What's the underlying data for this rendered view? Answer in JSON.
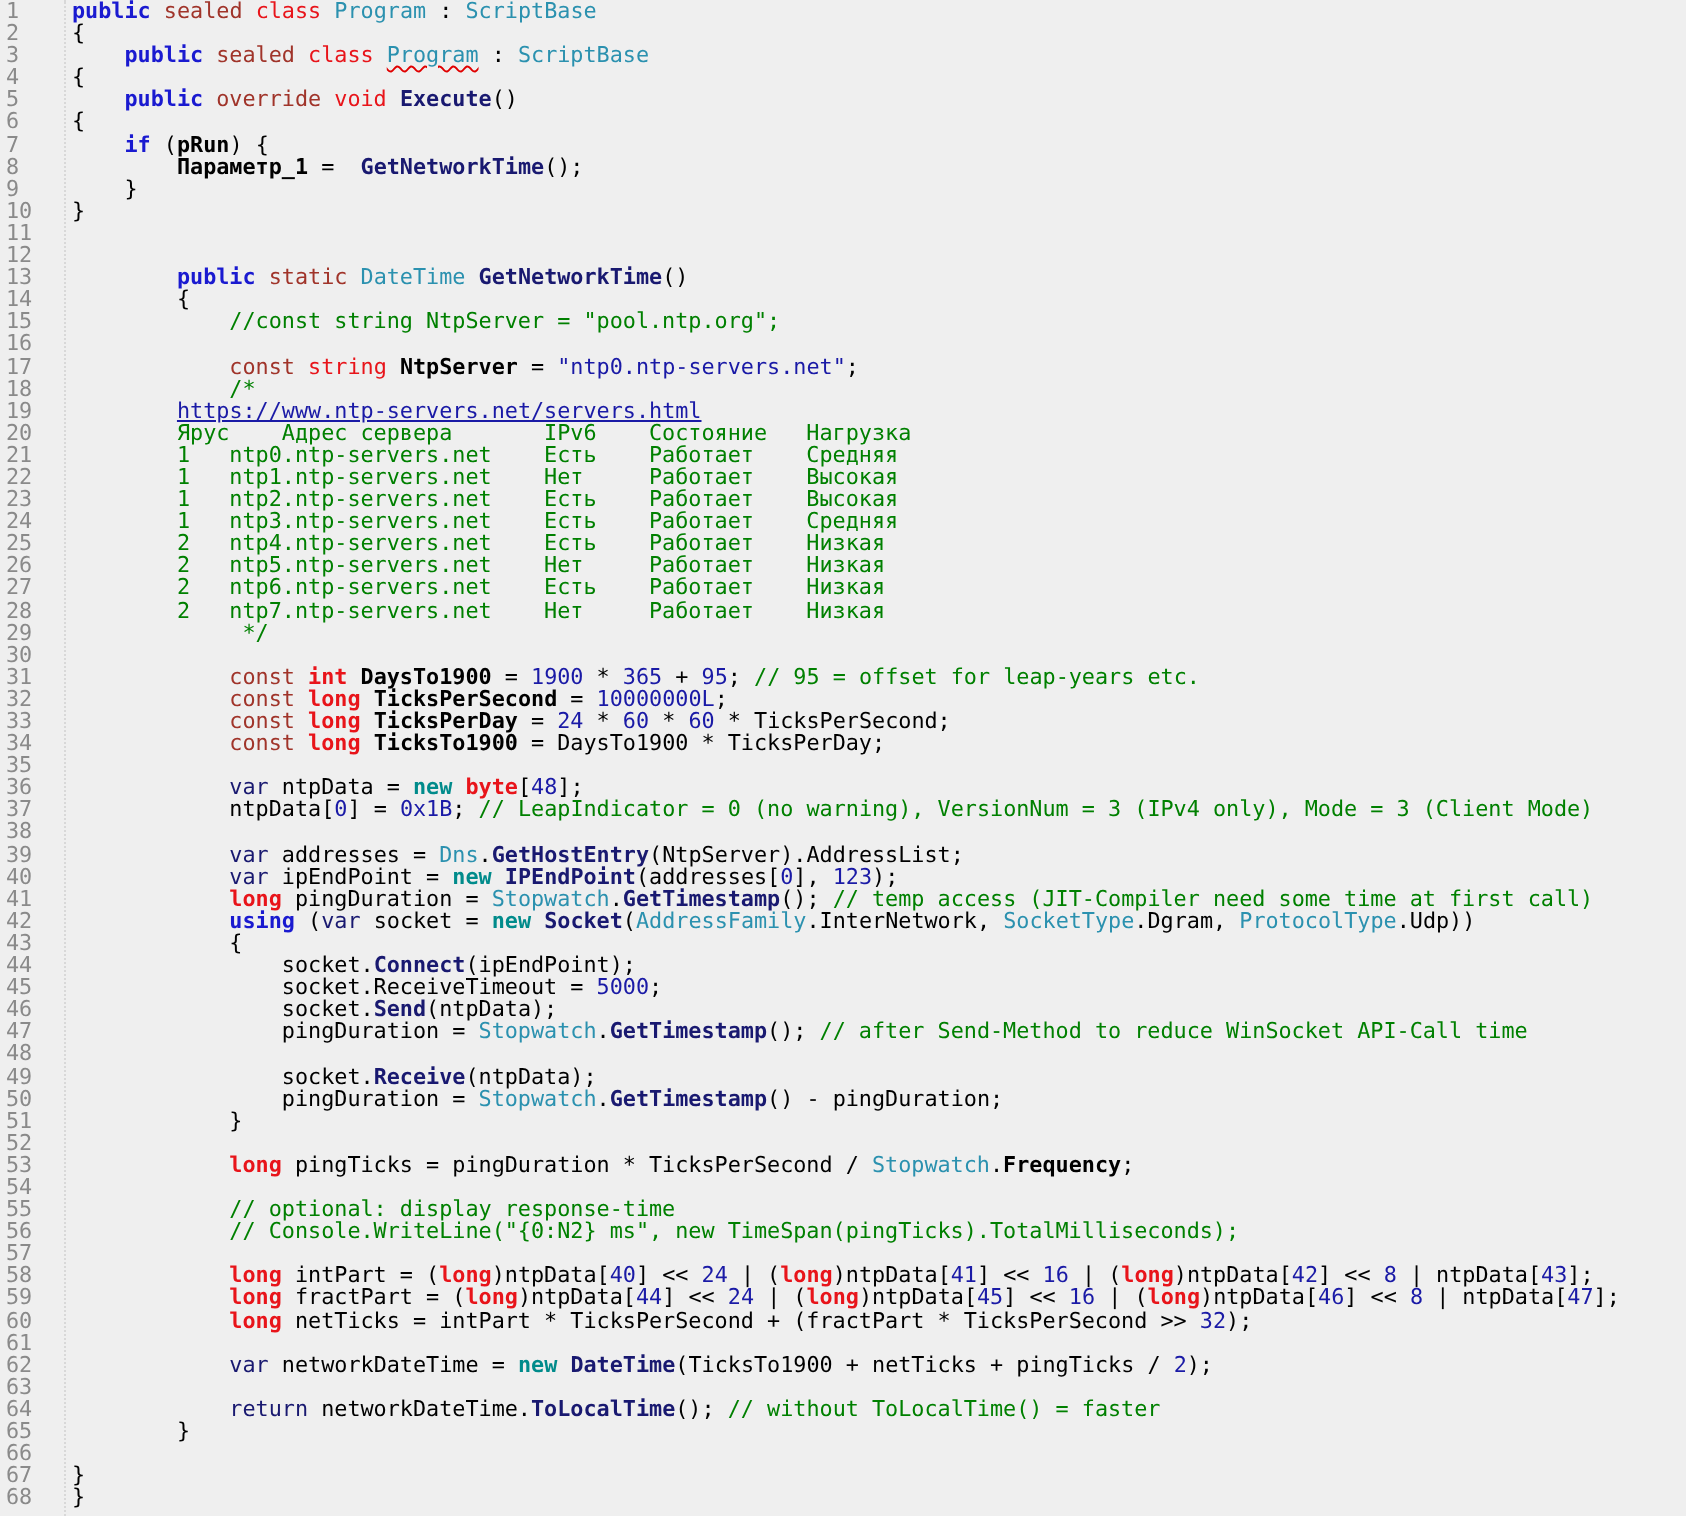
{
  "editor": {
    "lines": [
      {
        "number": "1",
        "tokens": [
          {
            "text": "public ",
            "kind": "kw"
          },
          {
            "text": "sealed ",
            "kind": "mod"
          },
          {
            "text": "class ",
            "kind": "tkw"
          },
          {
            "text": "Program",
            "kind": "type"
          },
          {
            "text": " : ",
            "kind": "plain"
          },
          {
            "text": "ScriptBase",
            "kind": "type"
          }
        ]
      },
      {
        "number": "2",
        "tokens": [
          {
            "text": "{",
            "kind": "plain"
          }
        ]
      },
      {
        "number": "3",
        "tokens": [
          {
            "text": "    public ",
            "kind": "kw"
          },
          {
            "text": "sealed ",
            "kind": "mod"
          },
          {
            "text": "class ",
            "kind": "tkw"
          },
          {
            "text": "Program",
            "kind": "type",
            "squiggle": true
          },
          {
            "text": " : ",
            "kind": "plain"
          },
          {
            "text": "ScriptBase",
            "kind": "type"
          }
        ]
      },
      {
        "number": "4",
        "tokens": [
          {
            "text": "{",
            "kind": "plain"
          }
        ]
      },
      {
        "number": "5",
        "tokens": [
          {
            "text": "    public ",
            "kind": "kw"
          },
          {
            "text": "override ",
            "kind": "mod"
          },
          {
            "text": "void ",
            "kind": "tkw"
          },
          {
            "text": "Execute",
            "kind": "method"
          },
          {
            "text": "()",
            "kind": "plain"
          }
        ]
      },
      {
        "number": "6",
        "tokens": [
          {
            "text": "{",
            "kind": "plain"
          }
        ]
      },
      {
        "number": "7",
        "tokens": [
          {
            "text": "    if ",
            "kind": "kw"
          },
          {
            "text": "(",
            "kind": "plain"
          },
          {
            "text": "pRun",
            "kind": "decl"
          },
          {
            "text": ") {",
            "kind": "plain"
          }
        ]
      },
      {
        "number": "8",
        "tokens": [
          {
            "text": "        Параметр_1",
            "kind": "decl"
          },
          {
            "text": " =  ",
            "kind": "plain"
          },
          {
            "text": "GetNetworkTime",
            "kind": "method"
          },
          {
            "text": "();",
            "kind": "plain"
          }
        ]
      },
      {
        "number": "9",
        "tokens": [
          {
            "text": "    }",
            "kind": "plain"
          }
        ]
      },
      {
        "number": "10",
        "tokens": [
          {
            "text": "}",
            "kind": "plain"
          }
        ]
      },
      {
        "number": "11"
      },
      {
        "number": "12"
      },
      {
        "number": "13",
        "tokens": [
          {
            "text": "        public ",
            "kind": "kw"
          },
          {
            "text": "static ",
            "kind": "mod"
          },
          {
            "text": "DateTime ",
            "kind": "type"
          },
          {
            "text": "GetNetworkTime",
            "kind": "method"
          },
          {
            "text": "()",
            "kind": "plain"
          }
        ]
      },
      {
        "number": "14",
        "tokens": [
          {
            "text": "        {",
            "kind": "plain"
          }
        ]
      },
      {
        "number": "15",
        "tokens": [
          {
            "text": "            //const string NtpServer = \"pool.ntp.org\";",
            "kind": "comment"
          }
        ]
      },
      {
        "number": "16"
      },
      {
        "number": "17",
        "tokens": [
          {
            "text": "            const ",
            "kind": "mod"
          },
          {
            "text": "string ",
            "kind": "tkw"
          },
          {
            "text": "NtpServer",
            "kind": "decl"
          },
          {
            "text": " = ",
            "kind": "plain"
          },
          {
            "text": "\"ntp0.ntp-servers.net\"",
            "kind": "str"
          },
          {
            "text": ";",
            "kind": "plain"
          }
        ]
      },
      {
        "number": "18",
        "tokens": [
          {
            "text": "            /*",
            "kind": "comment"
          }
        ]
      },
      {
        "number": "19",
        "tokens": [
          {
            "text": "        https://www.ntp-servers.net/servers.html",
            "kind": "link"
          }
        ]
      },
      {
        "number": "20",
        "tokens": [
          {
            "text": "        Ярус    Адрес сервера       IPv6    Состояние   Нагрузка",
            "kind": "comment"
          }
        ]
      },
      {
        "number": "21",
        "tokens": [
          {
            "text": "        1   ntp0.ntp-servers.net    Есть    Работает    Средняя",
            "kind": "comment"
          }
        ]
      },
      {
        "number": "22",
        "tokens": [
          {
            "text": "        1   ntp1.ntp-servers.net    Нет     Работает    Высокая",
            "kind": "comment"
          }
        ]
      },
      {
        "number": "23",
        "tokens": [
          {
            "text": "        1   ntp2.ntp-servers.net    Есть    Работает    Высокая",
            "kind": "comment"
          }
        ]
      },
      {
        "number": "24",
        "tokens": [
          {
            "text": "        1   ntp3.ntp-servers.net    Есть    Работает    Средняя",
            "kind": "comment"
          }
        ]
      },
      {
        "number": "25",
        "tokens": [
          {
            "text": "        2   ntp4.ntp-servers.net    Есть    Работает    Низкая",
            "kind": "comment"
          }
        ]
      },
      {
        "number": "26",
        "tokens": [
          {
            "text": "        2   ntp5.ntp-servers.net    Нет     Работает    Низкая",
            "kind": "comment"
          }
        ]
      },
      {
        "number": "27",
        "tokens": [
          {
            "text": "        2   ntp6.ntp-servers.net    Есть    Работает    Низкая",
            "kind": "comment"
          }
        ]
      },
      {
        "number": "28",
        "tokens": [
          {
            "text": "        2   ntp7.ntp-servers.net    Нет     Работает    Низкая",
            "kind": "comment"
          }
        ]
      },
      {
        "number": "29",
        "tokens": [
          {
            "text": "             */",
            "kind": "comment"
          }
        ]
      },
      {
        "number": "30"
      },
      {
        "number": "31",
        "tokens": [
          {
            "text": "            const ",
            "kind": "mod"
          },
          {
            "text": "int ",
            "kind": "prim"
          },
          {
            "text": "DaysTo1900",
            "kind": "decl"
          },
          {
            "text": " = ",
            "kind": "plain"
          },
          {
            "text": "1900",
            "kind": "num"
          },
          {
            "text": " * ",
            "kind": "plain"
          },
          {
            "text": "365",
            "kind": "num"
          },
          {
            "text": " + ",
            "kind": "plain"
          },
          {
            "text": "95",
            "kind": "num"
          },
          {
            "text": "; ",
            "kind": "plain"
          },
          {
            "text": "// 95 = offset for leap-years etc.",
            "kind": "comment"
          }
        ]
      },
      {
        "number": "32",
        "tokens": [
          {
            "text": "            const ",
            "kind": "mod"
          },
          {
            "text": "long ",
            "kind": "prim"
          },
          {
            "text": "TicksPerSecond",
            "kind": "decl"
          },
          {
            "text": " = ",
            "kind": "plain"
          },
          {
            "text": "10000000L",
            "kind": "num"
          },
          {
            "text": ";",
            "kind": "plain"
          }
        ]
      },
      {
        "number": "33",
        "tokens": [
          {
            "text": "            const ",
            "kind": "mod"
          },
          {
            "text": "long ",
            "kind": "prim"
          },
          {
            "text": "TicksPerDay",
            "kind": "decl"
          },
          {
            "text": " = ",
            "kind": "plain"
          },
          {
            "text": "24",
            "kind": "num"
          },
          {
            "text": " * ",
            "kind": "plain"
          },
          {
            "text": "60",
            "kind": "num"
          },
          {
            "text": " * ",
            "kind": "plain"
          },
          {
            "text": "60",
            "kind": "num"
          },
          {
            "text": " * TicksPerSecond;",
            "kind": "plain"
          }
        ]
      },
      {
        "number": "34",
        "tokens": [
          {
            "text": "            const ",
            "kind": "mod"
          },
          {
            "text": "long ",
            "kind": "prim"
          },
          {
            "text": "TicksTo1900",
            "kind": "decl"
          },
          {
            "text": " = DaysTo1900 * TicksPerDay;",
            "kind": "plain"
          }
        ]
      },
      {
        "number": "35"
      },
      {
        "number": "36",
        "tokens": [
          {
            "text": "            var ",
            "kind": "var"
          },
          {
            "text": "ntpData = ",
            "kind": "plain"
          },
          {
            "text": "new ",
            "kind": "new"
          },
          {
            "text": "byte",
            "kind": "prim"
          },
          {
            "text": "[",
            "kind": "plain"
          },
          {
            "text": "48",
            "kind": "num"
          },
          {
            "text": "];",
            "kind": "plain"
          }
        ]
      },
      {
        "number": "37",
        "tokens": [
          {
            "text": "            ntpData[",
            "kind": "plain"
          },
          {
            "text": "0",
            "kind": "num"
          },
          {
            "text": "] = ",
            "kind": "plain"
          },
          {
            "text": "0x1B",
            "kind": "num"
          },
          {
            "text": "; ",
            "kind": "plain"
          },
          {
            "text": "// LeapIndicator = 0 (no warning), VersionNum = 3 (IPv4 only), Mode = 3 (Client Mode)",
            "kind": "comment"
          }
        ]
      },
      {
        "number": "38"
      },
      {
        "number": "39",
        "tokens": [
          {
            "text": "            var ",
            "kind": "var"
          },
          {
            "text": "addresses = ",
            "kind": "plain"
          },
          {
            "text": "Dns",
            "kind": "type"
          },
          {
            "text": ".",
            "kind": "plain"
          },
          {
            "text": "GetHostEntry",
            "kind": "method"
          },
          {
            "text": "(NtpServer).AddressList;",
            "kind": "plain"
          }
        ]
      },
      {
        "number": "40",
        "tokens": [
          {
            "text": "            var ",
            "kind": "var"
          },
          {
            "text": "ipEndPoint = ",
            "kind": "plain"
          },
          {
            "text": "new ",
            "kind": "new"
          },
          {
            "text": "IPEndPoint",
            "kind": "method"
          },
          {
            "text": "(addresses[",
            "kind": "plain"
          },
          {
            "text": "0",
            "kind": "num"
          },
          {
            "text": "], ",
            "kind": "plain"
          },
          {
            "text": "123",
            "kind": "num"
          },
          {
            "text": ");",
            "kind": "plain"
          }
        ]
      },
      {
        "number": "41",
        "tokens": [
          {
            "text": "            long ",
            "kind": "prim"
          },
          {
            "text": "pingDuration = ",
            "kind": "plain"
          },
          {
            "text": "Stopwatch",
            "kind": "type"
          },
          {
            "text": ".",
            "kind": "plain"
          },
          {
            "text": "GetTimestamp",
            "kind": "method"
          },
          {
            "text": "(); ",
            "kind": "plain"
          },
          {
            "text": "// temp access (JIT-Compiler need some time at first call)",
            "kind": "comment"
          }
        ]
      },
      {
        "number": "42",
        "tokens": [
          {
            "text": "            using ",
            "kind": "kw"
          },
          {
            "text": "(",
            "kind": "plain"
          },
          {
            "text": "var ",
            "kind": "var"
          },
          {
            "text": "socket = ",
            "kind": "plain"
          },
          {
            "text": "new ",
            "kind": "new"
          },
          {
            "text": "Socket",
            "kind": "method"
          },
          {
            "text": "(",
            "kind": "plain"
          },
          {
            "text": "AddressFamily",
            "kind": "type"
          },
          {
            "text": ".InterNetwork, ",
            "kind": "plain"
          },
          {
            "text": "SocketType",
            "kind": "type"
          },
          {
            "text": ".Dgram, ",
            "kind": "plain"
          },
          {
            "text": "ProtocolType",
            "kind": "type"
          },
          {
            "text": ".Udp))",
            "kind": "plain"
          }
        ]
      },
      {
        "number": "43",
        "tokens": [
          {
            "text": "            {",
            "kind": "plain"
          }
        ]
      },
      {
        "number": "44",
        "tokens": [
          {
            "text": "                socket.",
            "kind": "plain"
          },
          {
            "text": "Connect",
            "kind": "method"
          },
          {
            "text": "(ipEndPoint);",
            "kind": "plain"
          }
        ]
      },
      {
        "number": "45",
        "tokens": [
          {
            "text": "                socket.ReceiveTimeout = ",
            "kind": "plain"
          },
          {
            "text": "5000",
            "kind": "num"
          },
          {
            "text": ";",
            "kind": "plain"
          }
        ]
      },
      {
        "number": "46",
        "tokens": [
          {
            "text": "                socket.",
            "kind": "plain"
          },
          {
            "text": "Send",
            "kind": "method"
          },
          {
            "text": "(ntpData);",
            "kind": "plain"
          }
        ]
      },
      {
        "number": "47",
        "tokens": [
          {
            "text": "                pingDuration = ",
            "kind": "plain"
          },
          {
            "text": "Stopwatch",
            "kind": "type"
          },
          {
            "text": ".",
            "kind": "plain"
          },
          {
            "text": "GetTimestamp",
            "kind": "method"
          },
          {
            "text": "(); ",
            "kind": "plain"
          },
          {
            "text": "// after Send-Method to reduce WinSocket API-Call time",
            "kind": "comment"
          }
        ]
      },
      {
        "number": "48"
      },
      {
        "number": "49",
        "tokens": [
          {
            "text": "                socket.",
            "kind": "plain"
          },
          {
            "text": "Receive",
            "kind": "method"
          },
          {
            "text": "(ntpData);",
            "kind": "plain"
          }
        ]
      },
      {
        "number": "50",
        "tokens": [
          {
            "text": "                pingDuration = ",
            "kind": "plain"
          },
          {
            "text": "Stopwatch",
            "kind": "type"
          },
          {
            "text": ".",
            "kind": "plain"
          },
          {
            "text": "GetTimestamp",
            "kind": "method"
          },
          {
            "text": "() - pingDuration;",
            "kind": "plain"
          }
        ]
      },
      {
        "number": "51",
        "tokens": [
          {
            "text": "            }",
            "kind": "plain"
          }
        ]
      },
      {
        "number": "52"
      },
      {
        "number": "53",
        "tokens": [
          {
            "text": "            long ",
            "kind": "prim"
          },
          {
            "text": "pingTicks = pingDuration * TicksPerSecond / ",
            "kind": "plain"
          },
          {
            "text": "Stopwatch",
            "kind": "type"
          },
          {
            "text": ".",
            "kind": "plain"
          },
          {
            "text": "Frequency",
            "kind": "decl"
          },
          {
            "text": ";",
            "kind": "plain"
          }
        ]
      },
      {
        "number": "54"
      },
      {
        "number": "55",
        "tokens": [
          {
            "text": "            // optional: display response-time",
            "kind": "comment"
          }
        ]
      },
      {
        "number": "56",
        "tokens": [
          {
            "text": "            // Console.WriteLine(\"{0:N2} ms\", new TimeSpan(pingTicks).TotalMilliseconds);",
            "kind": "comment"
          }
        ]
      },
      {
        "number": "57"
      },
      {
        "number": "58",
        "tokens": [
          {
            "text": "            long ",
            "kind": "prim"
          },
          {
            "text": "intPart = (",
            "kind": "plain"
          },
          {
            "text": "long",
            "kind": "prim"
          },
          {
            "text": ")ntpData[",
            "kind": "plain"
          },
          {
            "text": "40",
            "kind": "num"
          },
          {
            "text": "] << ",
            "kind": "plain"
          },
          {
            "text": "24",
            "kind": "num"
          },
          {
            "text": " | (",
            "kind": "plain"
          },
          {
            "text": "long",
            "kind": "prim"
          },
          {
            "text": ")ntpData[",
            "kind": "plain"
          },
          {
            "text": "41",
            "kind": "num"
          },
          {
            "text": "] << ",
            "kind": "plain"
          },
          {
            "text": "16",
            "kind": "num"
          },
          {
            "text": " | (",
            "kind": "plain"
          },
          {
            "text": "long",
            "kind": "prim"
          },
          {
            "text": ")ntpData[",
            "kind": "plain"
          },
          {
            "text": "42",
            "kind": "num"
          },
          {
            "text": "] << ",
            "kind": "plain"
          },
          {
            "text": "8",
            "kind": "num"
          },
          {
            "text": " | ntpData[",
            "kind": "plain"
          },
          {
            "text": "43",
            "kind": "num"
          },
          {
            "text": "];",
            "kind": "plain"
          }
        ]
      },
      {
        "number": "59",
        "tokens": [
          {
            "text": "            long ",
            "kind": "prim"
          },
          {
            "text": "fractPart = (",
            "kind": "plain"
          },
          {
            "text": "long",
            "kind": "prim"
          },
          {
            "text": ")ntpData[",
            "kind": "plain"
          },
          {
            "text": "44",
            "kind": "num"
          },
          {
            "text": "] << ",
            "kind": "plain"
          },
          {
            "text": "24",
            "kind": "num"
          },
          {
            "text": " | (",
            "kind": "plain"
          },
          {
            "text": "long",
            "kind": "prim"
          },
          {
            "text": ")ntpData[",
            "kind": "plain"
          },
          {
            "text": "45",
            "kind": "num"
          },
          {
            "text": "] << ",
            "kind": "plain"
          },
          {
            "text": "16",
            "kind": "num"
          },
          {
            "text": " | (",
            "kind": "plain"
          },
          {
            "text": "long",
            "kind": "prim"
          },
          {
            "text": ")ntpData[",
            "kind": "plain"
          },
          {
            "text": "46",
            "kind": "num"
          },
          {
            "text": "] << ",
            "kind": "plain"
          },
          {
            "text": "8",
            "kind": "num"
          },
          {
            "text": " | ntpData[",
            "kind": "plain"
          },
          {
            "text": "47",
            "kind": "num"
          },
          {
            "text": "];",
            "kind": "plain"
          }
        ]
      },
      {
        "number": "60",
        "tokens": [
          {
            "text": "            long ",
            "kind": "prim"
          },
          {
            "text": "netTicks = intPart * TicksPerSecond + (fractPart * TicksPerSecond >> ",
            "kind": "plain"
          },
          {
            "text": "32",
            "kind": "num"
          },
          {
            "text": ");",
            "kind": "plain"
          }
        ]
      },
      {
        "number": "61"
      },
      {
        "number": "62",
        "tokens": [
          {
            "text": "            var ",
            "kind": "var"
          },
          {
            "text": "networkDateTime = ",
            "kind": "plain"
          },
          {
            "text": "new ",
            "kind": "new"
          },
          {
            "text": "DateTime",
            "kind": "method"
          },
          {
            "text": "(TicksTo1900 + netTicks + pingTicks / ",
            "kind": "plain"
          },
          {
            "text": "2",
            "kind": "num"
          },
          {
            "text": ");",
            "kind": "plain"
          }
        ]
      },
      {
        "number": "63"
      },
      {
        "number": "64",
        "tokens": [
          {
            "text": "            return ",
            "kind": "var"
          },
          {
            "text": "networkDateTime.",
            "kind": "plain"
          },
          {
            "text": "ToLocalTime",
            "kind": "method"
          },
          {
            "text": "(); ",
            "kind": "plain"
          },
          {
            "text": "// without ToLocalTime() = faster",
            "kind": "comment"
          }
        ]
      },
      {
        "number": "65",
        "tokens": [
          {
            "text": "        }",
            "kind": "plain"
          }
        ]
      },
      {
        "number": "66"
      },
      {
        "number": "67",
        "tokens": [
          {
            "text": "}",
            "kind": "plain"
          }
        ]
      },
      {
        "number": "68",
        "tokens": [
          {
            "text": "}",
            "kind": "plain"
          }
        ]
      }
    ]
  }
}
